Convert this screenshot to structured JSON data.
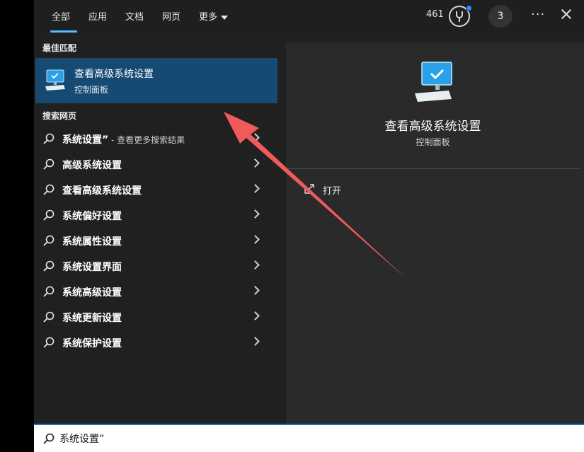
{
  "tabs": [
    {
      "label": "全部"
    },
    {
      "label": "应用"
    },
    {
      "label": "文档"
    },
    {
      "label": "网页"
    },
    {
      "label": "更多"
    }
  ],
  "header": {
    "points": "461",
    "badge_count": "3",
    "more_icon": "ellipsis-icon",
    "close_icon": "close-icon"
  },
  "best_match": {
    "section_label": "最佳匹配",
    "title": "查看高级系统设置",
    "subtitle": "控制面板"
  },
  "web_search": {
    "section_label": "搜索网页",
    "items": [
      {
        "label": "系统设置”",
        "hint": " - 查看更多搜索结果"
      },
      {
        "label": "高级系统设置",
        "hint": ""
      },
      {
        "label": "查看高级系统设置",
        "hint": ""
      },
      {
        "label": "系统偏好设置",
        "hint": ""
      },
      {
        "label": "系统属性设置",
        "hint": ""
      },
      {
        "label": "系统设置界面",
        "hint": ""
      },
      {
        "label": "系统高级设置",
        "hint": ""
      },
      {
        "label": "系统更新设置",
        "hint": ""
      },
      {
        "label": "系统保护设置",
        "hint": ""
      }
    ]
  },
  "preview": {
    "title": "查看高级系统设置",
    "subtitle": "控制面板",
    "open_label": "打开"
  },
  "search": {
    "value": "系统设置”"
  },
  "colors": {
    "accent": "#4cc2ff",
    "selected_bg": "#164a73",
    "annotation_arrow": "#f05a5a"
  }
}
